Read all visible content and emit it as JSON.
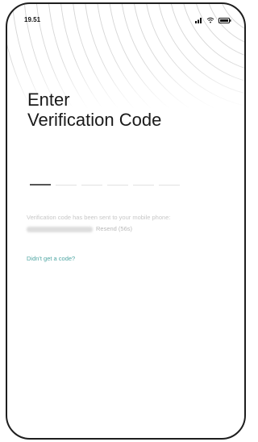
{
  "status_bar": {
    "time": "19.51",
    "icons": [
      "signal-icon",
      "wifi-icon",
      "battery-icon"
    ]
  },
  "header": {
    "title_line1": "Enter",
    "title_line2": "Verification Code"
  },
  "code_input": {
    "slot_count": 6,
    "entered": ""
  },
  "info": {
    "message": "Verification code has been sent to your mobile phone:",
    "resend_label": "Resend (56s)"
  },
  "help": {
    "link_label": "Didn't get a code?"
  },
  "colors": {
    "accent": "#4fa6a3",
    "text_dark": "#1a1a1a",
    "text_muted": "#c7c7c7",
    "arc_stroke": "#cfcfcf"
  }
}
